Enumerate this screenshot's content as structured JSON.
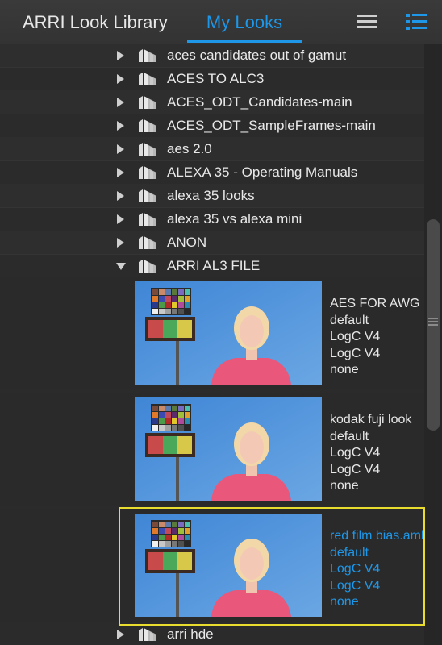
{
  "header": {
    "tab_library": "ARRI Look Library",
    "tab_my_looks": "My Looks",
    "accent_color": "#1e97e8"
  },
  "folders_top": [
    {
      "label": "aces candidates out of gamut"
    },
    {
      "label": "ACES TO ALC3"
    },
    {
      "label": "ACES_ODT_Candidates-main"
    },
    {
      "label": "ACES_ODT_SampleFrames-main"
    },
    {
      "label": "aes 2.0"
    },
    {
      "label": "ALEXA 35 - Operating Manuals"
    },
    {
      "label": "alexa 35 looks"
    },
    {
      "label": "alexa 35 vs alexa mini"
    },
    {
      "label": "ANON"
    }
  ],
  "expanded_folder": {
    "label": "ARRI AL3 FILE"
  },
  "looks": [
    {
      "name": "AES FOR  AWG",
      "preset": "default",
      "input": "LogC V4",
      "output": "LogC V4",
      "extra": "none",
      "selected": false
    },
    {
      "name": "kodak fuji look",
      "preset": "default",
      "input": "LogC V4",
      "output": "LogC V4",
      "extra": "none",
      "selected": false
    },
    {
      "name": "red film bias.aml",
      "preset": "default",
      "input": "LogC V4",
      "output": "LogC V4",
      "extra": "none",
      "selected": true
    }
  ],
  "folders_bottom": [
    {
      "label": "arri hde"
    }
  ]
}
